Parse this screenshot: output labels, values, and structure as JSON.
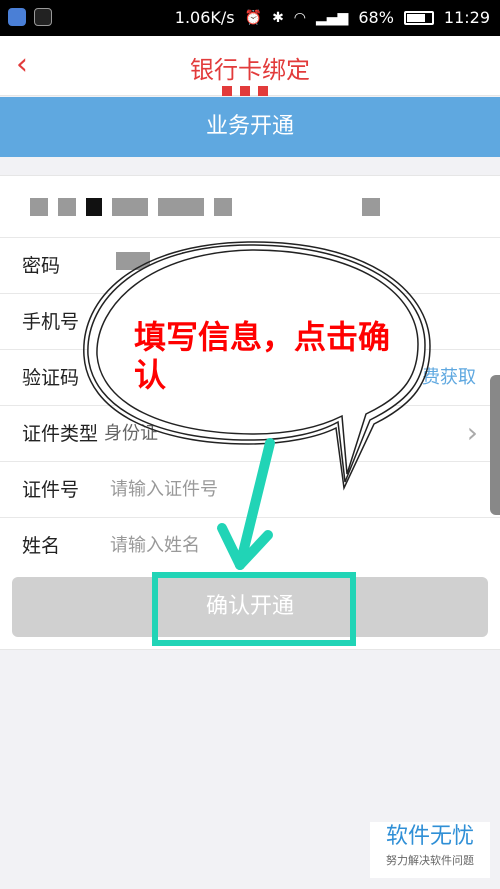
{
  "status_bar": {
    "network_speed": "1.06K/s",
    "battery_percent": "68%",
    "time": "11:29"
  },
  "header": {
    "title": "银行卡绑定",
    "back_icon": "chevron-left-icon"
  },
  "banner": {
    "text": "业务开通"
  },
  "form": {
    "password_label": "密码",
    "phone_label": "手机号",
    "code_label": "验证码",
    "get_code_label": "费获取",
    "id_type_label": "证件类型",
    "id_type_value": "身份证",
    "id_no_label": "证件号",
    "id_no_placeholder": "请输入证件号",
    "name_label": "姓名",
    "name_placeholder": "请输入姓名"
  },
  "confirm_button": {
    "label": "确认开通"
  },
  "annotation": {
    "bubble_text": "填写信息，点击确认"
  },
  "watermark": {
    "title": "软件无忧",
    "subtitle": "努力解决软件问题"
  },
  "colors": {
    "accent_red": "#e23b3b",
    "banner_blue": "#5fa8e0",
    "highlight_teal": "#21d4b6"
  }
}
